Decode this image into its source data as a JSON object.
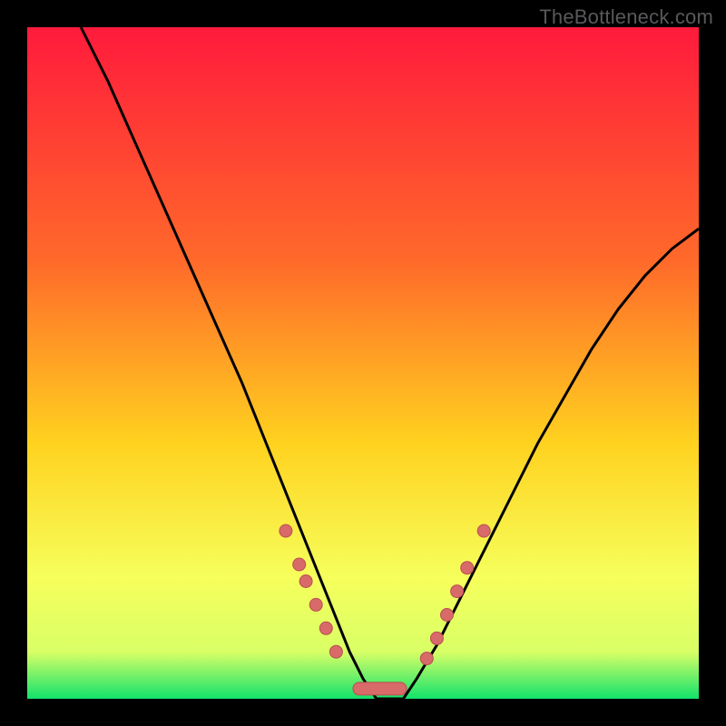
{
  "watermark_text": "TheBottleneck.com",
  "colors": {
    "bg_black": "#000000",
    "grad_top": "#ff1a3c",
    "grad_mid1": "#ff6a2a",
    "grad_mid2": "#ffd21f",
    "grad_low1": "#f6ff5c",
    "grad_low2": "#d9ff66",
    "grad_bottom": "#12e26b",
    "curve": "#000000",
    "marker_fill": "#d86a6a",
    "marker_stroke": "#b94f4f"
  },
  "chart_data": {
    "type": "line",
    "title": "",
    "xlabel": "",
    "ylabel": "",
    "xlim": [
      0,
      100
    ],
    "ylim": [
      0,
      100
    ],
    "series": [
      {
        "name": "bottleneck-curve",
        "x": [
          8,
          12,
          16,
          20,
          24,
          28,
          32,
          34,
          36,
          38,
          40,
          42,
          44,
          46,
          48,
          50,
          52,
          54,
          56,
          58,
          61,
          64,
          68,
          72,
          76,
          80,
          84,
          88,
          92,
          96,
          100
        ],
        "y": [
          100,
          92,
          83,
          74,
          65,
          56,
          47,
          42,
          37,
          32,
          27,
          22,
          17,
          12,
          7,
          3,
          0,
          0,
          0,
          3,
          8,
          14,
          22,
          30,
          38,
          45,
          52,
          58,
          63,
          67,
          70
        ]
      }
    ],
    "markers_left": [
      {
        "x": 38.5,
        "y": 25
      },
      {
        "x": 40.5,
        "y": 20
      },
      {
        "x": 41.5,
        "y": 17.5
      },
      {
        "x": 43.0,
        "y": 14
      },
      {
        "x": 44.5,
        "y": 10.5
      },
      {
        "x": 46.0,
        "y": 7
      }
    ],
    "markers_right": [
      {
        "x": 59.5,
        "y": 6
      },
      {
        "x": 61.0,
        "y": 9
      },
      {
        "x": 62.5,
        "y": 12.5
      },
      {
        "x": 64.0,
        "y": 16
      },
      {
        "x": 65.5,
        "y": 19.5
      },
      {
        "x": 68.0,
        "y": 25
      }
    ],
    "plateau": {
      "x0": 48.5,
      "x1": 56.5,
      "y": 1.5
    }
  }
}
